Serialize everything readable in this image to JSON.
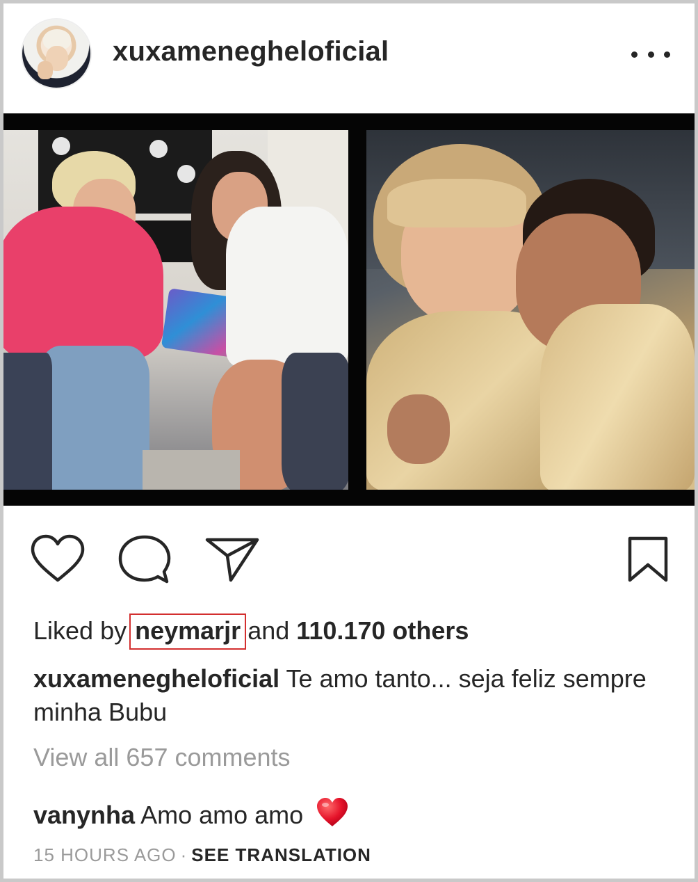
{
  "post": {
    "username": "xuxamenegheloficial",
    "more_icon": "more-horizontal-icon"
  },
  "actions": {
    "like_icon": "heart-outline-icon",
    "comment_icon": "comment-bubble-icon",
    "share_icon": "paper-plane-icon",
    "save_icon": "bookmark-icon"
  },
  "likes": {
    "prefix": "Liked by",
    "liker": "neymarjr",
    "middle": "and",
    "count_text": "110.170 others"
  },
  "caption": {
    "username": "xuxamenegheloficial",
    "text": "Te amo tanto... seja feliz sempre  minha Bubu"
  },
  "comments": {
    "view_all": "View all 657 comments",
    "items": [
      {
        "username": "vanynha",
        "text": "Amo amo amo",
        "emoji": "red-heart-emoji"
      }
    ]
  },
  "meta": {
    "timestamp": "15 HOURS AGO",
    "separator": "·",
    "translate": "SEE TRANSLATION"
  },
  "colors": {
    "text": "#262626",
    "muted": "#9a9a9a",
    "highlight_box": "#d32f2f"
  }
}
